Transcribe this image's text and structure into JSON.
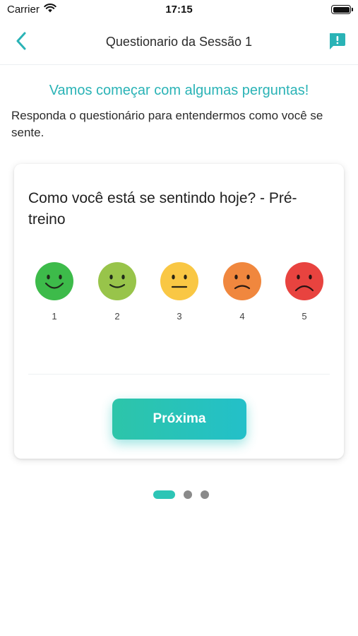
{
  "status_bar": {
    "carrier": "Carrier",
    "time": "17:15",
    "icons": [
      "wifi-icon",
      "battery-icon"
    ]
  },
  "nav": {
    "title": "Questionario da Sessão 1",
    "back_icon": "chevron-left-icon",
    "report_icon": "feedback-icon",
    "accent_color": "#2ab3b6"
  },
  "intro": {
    "heading": "Vamos começar com algumas perguntas!",
    "subtitle": "Responda o questionário para entendermos como você se sente."
  },
  "card": {
    "question": "Como você está se sentindo hoje? - Pré-treino",
    "faces": [
      {
        "label": "1",
        "color": "#3dbb4a",
        "mood": "very-happy"
      },
      {
        "label": "2",
        "color": "#98c44a",
        "mood": "happy"
      },
      {
        "label": "3",
        "color": "#f9c744",
        "mood": "neutral"
      },
      {
        "label": "4",
        "color": "#f0873e",
        "mood": "sad"
      },
      {
        "label": "5",
        "color": "#e8433f",
        "mood": "very-sad"
      }
    ],
    "next_label": "Próxima"
  },
  "pager": {
    "total": 3,
    "current": 1
  }
}
